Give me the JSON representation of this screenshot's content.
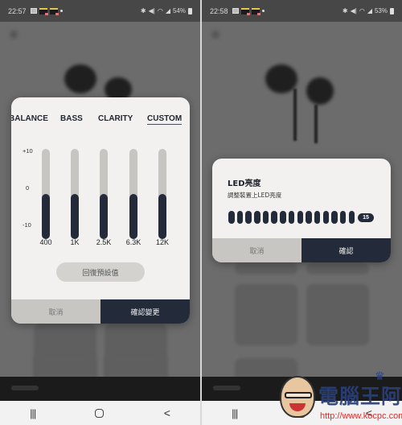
{
  "left_screen": {
    "status_bar": {
      "time": "22:57",
      "battery": "54%",
      "icons": [
        "gallery-icon",
        "app-notification-icon",
        "app-notification-icon",
        "dot-icon",
        "bluetooth-icon",
        "mute-icon",
        "wifi-icon",
        "signal-icon",
        "battery-icon"
      ]
    },
    "eq_dialog": {
      "tabs": [
        {
          "label": "BALANCE",
          "active": false
        },
        {
          "label": "BASS",
          "active": false
        },
        {
          "label": "CLARITY",
          "active": false
        },
        {
          "label": "CUSTOM",
          "active": true
        }
      ],
      "scale": {
        "max": "+10",
        "mid": "0",
        "min": "-10"
      },
      "bands": [
        {
          "freq": "400",
          "gain": 0
        },
        {
          "freq": "1K",
          "gain": 0
        },
        {
          "freq": "2.5K",
          "gain": 0
        },
        {
          "freq": "6.3K",
          "gain": 0
        },
        {
          "freq": "12K",
          "gain": 0
        }
      ],
      "reset_label": "回復預設值",
      "cancel_label": "取消",
      "confirm_label": "確認變更"
    },
    "nav": {
      "recent": "|||",
      "home": "home",
      "back": "<"
    }
  },
  "right_screen": {
    "status_bar": {
      "time": "22:58",
      "battery": "53%",
      "icons": [
        "gallery-icon",
        "app-notification-icon",
        "app-notification-icon",
        "dot-icon",
        "bluetooth-icon",
        "mute-icon",
        "wifi-icon",
        "signal-icon",
        "battery-icon"
      ]
    },
    "led_dialog": {
      "title": "LED亮度",
      "subtitle": "調整裝置上LED亮度",
      "level": 15,
      "max_level": 15,
      "level_label": "15",
      "cancel_label": "取消",
      "confirm_label": "確認"
    },
    "nav": {
      "recent": "|||",
      "home": "home",
      "back": "<"
    }
  },
  "watermark": {
    "title": "電腦王阿達",
    "url": "http://www.kocpc.com.tw"
  }
}
